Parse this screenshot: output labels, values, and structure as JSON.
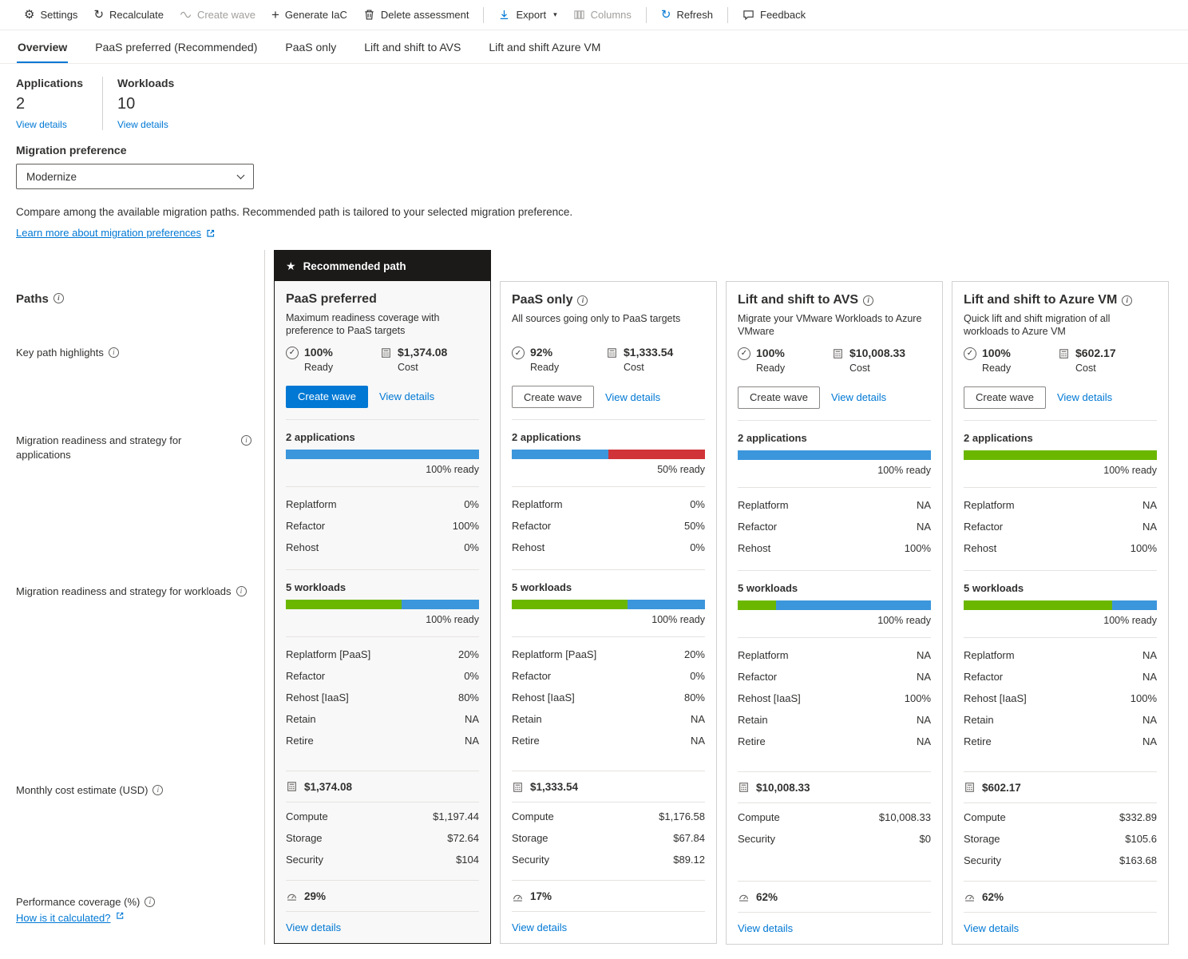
{
  "colors": {
    "accent": "#0078d4",
    "bar_blue": "#3c96dc",
    "bar_green": "#6bb700",
    "bar_red": "#d13438",
    "banner_bg": "#1b1a19"
  },
  "toolbar": {
    "items": [
      {
        "label": "Settings",
        "icon": "gear-icon",
        "enabled": true
      },
      {
        "label": "Recalculate",
        "icon": "recalculate-icon",
        "enabled": true
      },
      {
        "label": "Create wave",
        "icon": "wave-icon",
        "enabled": false
      },
      {
        "label": "Generate IaC",
        "icon": "plus-icon",
        "enabled": true
      },
      {
        "label": "Delete assessment",
        "icon": "trash-icon",
        "enabled": true
      },
      {
        "label": "Export",
        "icon": "download-icon",
        "enabled": true,
        "has_chevron": true
      },
      {
        "label": "Columns",
        "icon": "columns-icon",
        "enabled": false
      },
      {
        "label": "Refresh",
        "icon": "refresh-icon",
        "enabled": true
      },
      {
        "label": "Feedback",
        "icon": "feedback-icon",
        "enabled": true
      }
    ]
  },
  "tabs": [
    {
      "label": "Overview",
      "active": true
    },
    {
      "label": "PaaS preferred (Recommended)",
      "active": false
    },
    {
      "label": "PaaS only",
      "active": false
    },
    {
      "label": "Lift and shift to AVS",
      "active": false
    },
    {
      "label": "Lift and shift Azure VM",
      "active": false
    }
  ],
  "stats": [
    {
      "label": "Applications",
      "value": "2",
      "link": "View details"
    },
    {
      "label": "Workloads",
      "value": "10",
      "link": "View details"
    }
  ],
  "migration_preference": {
    "label": "Migration preference",
    "value": "Modernize"
  },
  "intro": {
    "description": "Compare among the available migration paths. Recommended path is tailored to your selected migration preference.",
    "learn_more": "Learn more about migration preferences"
  },
  "row_labels": {
    "paths": "Paths",
    "key_path_highlights": "Key path highlights",
    "apps_readiness": "Migration readiness and strategy for applications",
    "workloads_readiness": "Migration readiness and strategy for workloads",
    "monthly_cost": "Monthly cost estimate (USD)",
    "performance_coverage": "Performance coverage (%)",
    "how_calculated": "How is it calculated?"
  },
  "cards": [
    {
      "banner": "Recommended path",
      "title": "PaaS preferred",
      "description": "Maximum readiness coverage with preference to PaaS targets",
      "ready_value": "100%",
      "ready_label": "Ready",
      "cost_value": "$1,374.08",
      "cost_label": "Cost",
      "create_wave_label": "Create wave",
      "view_details_label": "View details",
      "applications": {
        "title": "2 applications",
        "ready_text": "100% ready",
        "bar": [
          {
            "color": "bar_blue",
            "pct": 100
          }
        ],
        "rows": [
          {
            "label": "Replatform",
            "value": "0%"
          },
          {
            "label": "Refactor",
            "value": "100%"
          },
          {
            "label": "Rehost",
            "value": "0%"
          }
        ]
      },
      "workloads": {
        "title": "5 workloads",
        "ready_text": "100% ready",
        "bar": [
          {
            "color": "bar_green",
            "pct": 60
          },
          {
            "color": "bar_blue",
            "pct": 40
          }
        ],
        "rows": [
          {
            "label": "Replatform [PaaS]",
            "value": "20%"
          },
          {
            "label": "Refactor",
            "value": "0%"
          },
          {
            "label": "Rehost [IaaS]",
            "value": "80%"
          },
          {
            "label": "Retain",
            "value": "NA"
          },
          {
            "label": "Retire",
            "value": "NA"
          }
        ]
      },
      "monthly_cost": {
        "total": "$1,374.08",
        "rows": [
          {
            "label": "Compute",
            "value": "$1,197.44"
          },
          {
            "label": "Storage",
            "value": "$72.64"
          },
          {
            "label": "Security",
            "value": "$104"
          }
        ]
      },
      "performance_coverage": "29%",
      "footer_link": "View details"
    },
    {
      "title": "PaaS only",
      "description": "All sources going only to PaaS targets",
      "ready_value": "92%",
      "ready_label": "Ready",
      "cost_value": "$1,333.54",
      "cost_label": "Cost",
      "create_wave_label": "Create wave",
      "view_details_label": "View details",
      "applications": {
        "title": "2 applications",
        "ready_text": "50% ready",
        "bar": [
          {
            "color": "bar_blue",
            "pct": 50
          },
          {
            "color": "bar_red",
            "pct": 50
          }
        ],
        "rows": [
          {
            "label": "Replatform",
            "value": "0%"
          },
          {
            "label": "Refactor",
            "value": "50%"
          },
          {
            "label": "Rehost",
            "value": "0%"
          }
        ]
      },
      "workloads": {
        "title": "5 workloads",
        "ready_text": "100% ready",
        "bar": [
          {
            "color": "bar_green",
            "pct": 60
          },
          {
            "color": "bar_blue",
            "pct": 40
          }
        ],
        "rows": [
          {
            "label": "Replatform [PaaS]",
            "value": "20%"
          },
          {
            "label": "Refactor",
            "value": "0%"
          },
          {
            "label": "Rehost [IaaS]",
            "value": "80%"
          },
          {
            "label": "Retain",
            "value": "NA"
          },
          {
            "label": "Retire",
            "value": "NA"
          }
        ]
      },
      "monthly_cost": {
        "total": "$1,333.54",
        "rows": [
          {
            "label": "Compute",
            "value": "$1,176.58"
          },
          {
            "label": "Storage",
            "value": "$67.84"
          },
          {
            "label": "Security",
            "value": "$89.12"
          }
        ]
      },
      "performance_coverage": "17%",
      "footer_link": "View details"
    },
    {
      "title": "Lift and shift to AVS",
      "description": "Migrate your VMware Workloads to Azure VMware",
      "ready_value": "100%",
      "ready_label": "Ready",
      "cost_value": "$10,008.33",
      "cost_label": "Cost",
      "create_wave_label": "Create wave",
      "view_details_label": "View details",
      "applications": {
        "title": "2 applications",
        "ready_text": "100% ready",
        "bar": [
          {
            "color": "bar_blue",
            "pct": 100
          }
        ],
        "rows": [
          {
            "label": "Replatform",
            "value": "NA"
          },
          {
            "label": "Refactor",
            "value": "NA"
          },
          {
            "label": "Rehost",
            "value": "100%"
          }
        ]
      },
      "workloads": {
        "title": "5 workloads",
        "ready_text": "100% ready",
        "bar": [
          {
            "color": "bar_green",
            "pct": 20
          },
          {
            "color": "bar_blue",
            "pct": 80
          }
        ],
        "rows": [
          {
            "label": "Replatform",
            "value": "NA"
          },
          {
            "label": "Refactor",
            "value": "NA"
          },
          {
            "label": "Rehost [IaaS]",
            "value": "100%"
          },
          {
            "label": "Retain",
            "value": "NA"
          },
          {
            "label": "Retire",
            "value": "NA"
          }
        ]
      },
      "monthly_cost": {
        "total": "$10,008.33",
        "rows": [
          {
            "label": "Compute",
            "value": "$10,008.33"
          },
          {
            "label": "Security",
            "value": "$0"
          }
        ]
      },
      "performance_coverage": "62%",
      "footer_link": "View details"
    },
    {
      "title": "Lift and shift to Azure VM",
      "description": "Quick lift and shift migration of all workloads to Azure VM",
      "ready_value": "100%",
      "ready_label": "Ready",
      "cost_value": "$602.17",
      "cost_label": "Cost",
      "create_wave_label": "Create wave",
      "view_details_label": "View details",
      "applications": {
        "title": "2 applications",
        "ready_text": "100% ready",
        "bar": [
          {
            "color": "bar_green",
            "pct": 100
          }
        ],
        "rows": [
          {
            "label": "Replatform",
            "value": "NA"
          },
          {
            "label": "Refactor",
            "value": "NA"
          },
          {
            "label": "Rehost",
            "value": "100%"
          }
        ]
      },
      "workloads": {
        "title": "5 workloads",
        "ready_text": "100% ready",
        "bar": [
          {
            "color": "bar_green",
            "pct": 77
          },
          {
            "color": "bar_blue",
            "pct": 23
          }
        ],
        "rows": [
          {
            "label": "Replatform",
            "value": "NA"
          },
          {
            "label": "Refactor",
            "value": "NA"
          },
          {
            "label": "Rehost [IaaS]",
            "value": "100%"
          },
          {
            "label": "Retain",
            "value": "NA"
          },
          {
            "label": "Retire",
            "value": "NA"
          }
        ]
      },
      "monthly_cost": {
        "total": "$602.17",
        "rows": [
          {
            "label": "Compute",
            "value": "$332.89"
          },
          {
            "label": "Storage",
            "value": "$105.6"
          },
          {
            "label": "Security",
            "value": "$163.68"
          }
        ]
      },
      "performance_coverage": "62%",
      "footer_link": "View details"
    }
  ]
}
